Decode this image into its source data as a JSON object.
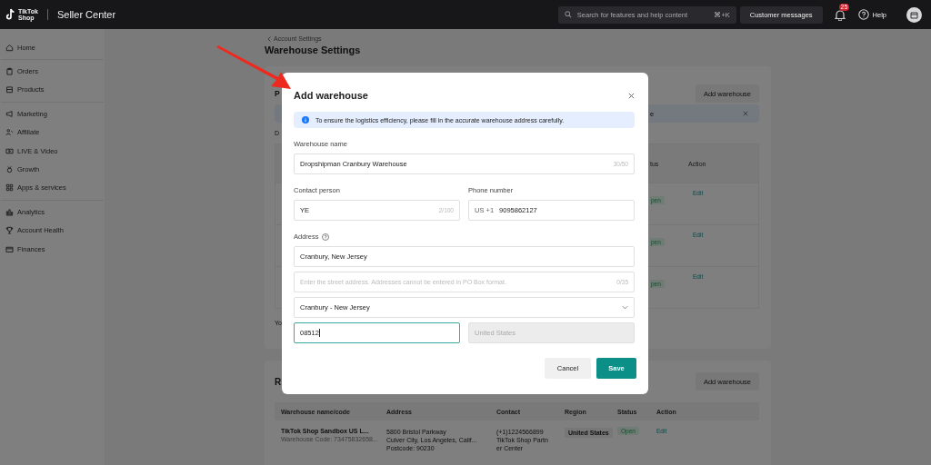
{
  "topbar": {
    "logo_lines": [
      "TikTok",
      "Shop"
    ],
    "product": "Seller Center",
    "search": {
      "placeholder": "Search for features and help content",
      "shortcut": "⌘+K"
    },
    "messages_button": "Customer messages",
    "notification_count": "25",
    "help": "Help"
  },
  "sidebar": {
    "groups": [
      {
        "items": [
          "Home"
        ]
      },
      {
        "items": [
          "Orders",
          "Products"
        ]
      },
      {
        "items": [
          "Marketing",
          "Affiliate",
          "LIVE & Video",
          "Growth",
          "Apps & services"
        ]
      },
      {
        "items": [
          "Analytics",
          "Account Health",
          "Finances"
        ]
      }
    ]
  },
  "page": {
    "breadcrumb": "Account Settings",
    "title": "Warehouse Settings"
  },
  "pickup_card": {
    "title": "P",
    "button": "Add warehouse",
    "notice": "e",
    "description": "D",
    "columns": [
      "tus",
      "Action"
    ],
    "rows": [
      {
        "status": "pen",
        "action": "Edit"
      },
      {
        "status": "pen",
        "action": "Edit"
      },
      {
        "status": "pen",
        "action": "Edit"
      }
    ],
    "footer": "Yo"
  },
  "return_card": {
    "title": "R",
    "button": "Add warehouse",
    "columns": [
      "Warehouse name/code",
      "Address",
      "Contact",
      "Region",
      "Status",
      "Action"
    ],
    "rows": [
      {
        "name": "TikTok Shop Sandbox US L...",
        "code": "Warehouse Code: 73475832658...",
        "address": [
          "5800 Bristol Parkway",
          "Culver City, Los Angeles, Calif...",
          "Postcode: 90230"
        ],
        "contact": [
          "(+1)1224566899",
          "TikTok Shop Partn",
          "er Center"
        ],
        "region": "United States",
        "status": "Open",
        "action": "Edit"
      }
    ]
  },
  "modal": {
    "title": "Add warehouse",
    "notice": "To ensure the logistics efficiency, please fill in the accurate warehouse address carefully.",
    "warehouse_name": {
      "label": "Warehouse name",
      "value": "Dropshipman Cranbury Warehouse",
      "counter": "30/50"
    },
    "contact_person": {
      "label": "Contact person",
      "value": "YE",
      "counter": "2/100"
    },
    "phone": {
      "label": "Phone number",
      "prefix": "US +1",
      "value": "9095862127"
    },
    "address": {
      "label": "Address",
      "line1": {
        "value": "Cranbury, New Jersey"
      },
      "street": {
        "placeholder": "Enter the street address. Addresses cannot be entered in PO Box format.",
        "counter": "0/35"
      },
      "city": {
        "value": "Cranbury - New Jersey"
      },
      "zip": {
        "value": "08512",
        "focused": true
      },
      "country": {
        "value": "United States",
        "disabled": true
      }
    },
    "buttons": {
      "cancel": "Cancel",
      "save": "Save"
    }
  }
}
